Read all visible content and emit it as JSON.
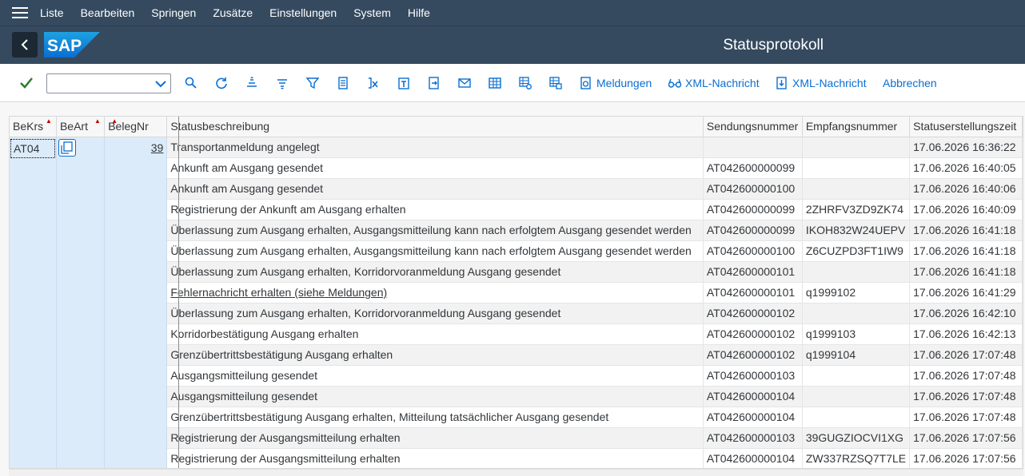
{
  "menu": {
    "items": [
      "Liste",
      "Bearbeiten",
      "Springen",
      "Zusätze",
      "Einstellungen",
      "System",
      "Hilfe"
    ]
  },
  "header": {
    "logo_text": "SAP",
    "title": "Statusprotokoll"
  },
  "toolbar": {
    "combo_value": "",
    "buttons": [
      "Meldungen",
      "XML-Nachricht",
      "XML-Nachricht",
      "Abbrechen"
    ]
  },
  "table": {
    "headers": [
      "BeKrs",
      "BeArt",
      "BelegNr",
      "Statusbeschreibung",
      "Sendungsnummer",
      "Empfangsnummer",
      "Statuserstellungszeit"
    ],
    "key": {
      "bekrs": "AT04",
      "beart": "",
      "belegnr": "39"
    },
    "rows": [
      [
        "Transportanmeldung angelegt",
        "",
        "",
        "17.06.2026 16:36:22"
      ],
      [
        "Ankunft am Ausgang gesendet",
        "AT042600000099",
        "",
        "17.06.2026 16:40:05"
      ],
      [
        "Ankunft am Ausgang gesendet",
        "AT042600000100",
        "",
        "17.06.2026 16:40:06"
      ],
      [
        "Registrierung der Ankunft am Ausgang erhalten",
        "AT042600000099",
        "2ZHRFV3ZD9ZK74",
        "17.06.2026 16:40:09"
      ],
      [
        "Überlassung zum Ausgang erhalten, Ausgangsmitteilung kann nach erfolgtem Ausgang gesendet werden",
        "AT042600000099",
        "IKOH832W24UEPV",
        "17.06.2026 16:41:18"
      ],
      [
        "Überlassung zum Ausgang erhalten, Ausgangsmitteilung kann nach erfolgtem Ausgang gesendet werden",
        "AT042600000100",
        "Z6CUZPD3FT1IW9",
        "17.06.2026 16:41:18"
      ],
      [
        "Überlassung zum Ausgang erhalten, Korridorvoranmeldung Ausgang gesendet",
        "AT042600000101",
        "",
        "17.06.2026 16:41:18"
      ],
      [
        "Fehlernachricht erhalten (siehe Meldungen)",
        "AT042600000101",
        "q1999102",
        "17.06.2026 16:41:29"
      ],
      [
        "Überlassung zum Ausgang erhalten, Korridorvoranmeldung Ausgang gesendet",
        "AT042600000102",
        "",
        "17.06.2026 16:42:10"
      ],
      [
        "Korridorbestätigung Ausgang erhalten",
        "AT042600000102",
        "q1999103",
        "17.06.2026 16:42:13"
      ],
      [
        "Grenzübertrittsbestätigung Ausgang erhalten",
        "AT042600000102",
        "q1999104",
        "17.06.2026 17:07:48"
      ],
      [
        "Ausgangsmitteilung gesendet",
        "AT042600000103",
        "",
        "17.06.2026 17:07:48"
      ],
      [
        "Ausgangsmitteilung gesendet",
        "AT042600000104",
        "",
        "17.06.2026 17:07:48"
      ],
      [
        "Grenzübertrittsbestätigung Ausgang erhalten, Mitteilung tatsächlicher Ausgang gesendet",
        "AT042600000104",
        "",
        "17.06.2026 17:07:48"
      ],
      [
        "Registrierung der Ausgangsmitteilung erhalten",
        "AT042600000103",
        "39GUGZIOCVI1XG",
        "17.06.2026 17:07:56"
      ],
      [
        "Registrierung der Ausgangsmitteilung erhalten",
        "AT042600000104",
        "ZW337RZSQ7T7LE",
        "17.06.2026 17:07:56"
      ]
    ]
  }
}
